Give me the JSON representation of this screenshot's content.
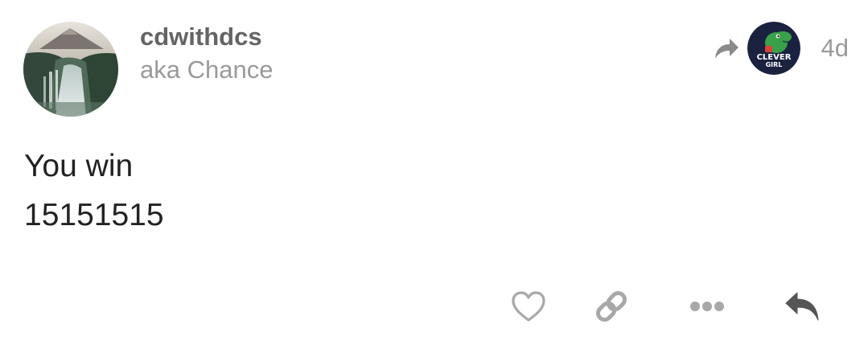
{
  "post": {
    "username": "cdwithdcs",
    "full_name": "aka Chance",
    "time_ago": "4d",
    "body_lines": [
      "You win",
      "15151515"
    ],
    "badge_text_top": "CLEVER",
    "badge_text_bottom": "GIRL"
  },
  "icons": {
    "share": "share-arrow-icon",
    "like": "heart-icon",
    "link": "link-icon",
    "more": "ellipsis-icon",
    "reply": "reply-icon"
  },
  "colors": {
    "username": "#646464",
    "secondary_text": "#9a9a9a",
    "body_text": "#222222",
    "icon_light": "#a8a8a8",
    "icon_dark": "#555555",
    "badge_bg": "#1b2240",
    "badge_dino": "#3aa04a"
  }
}
